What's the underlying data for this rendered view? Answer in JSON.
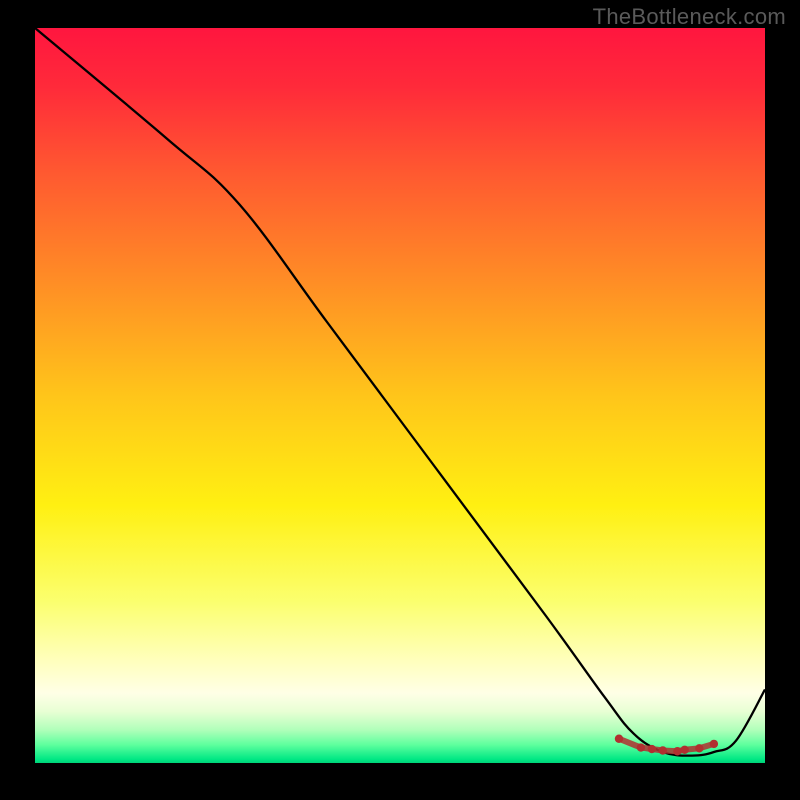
{
  "watermark": "TheBottleneck.com",
  "chart_data": {
    "type": "line",
    "title": "",
    "xlabel": "",
    "ylabel": "",
    "xlim": [
      0,
      100
    ],
    "ylim": [
      0,
      100
    ],
    "gradient_stops": [
      {
        "offset": 0.0,
        "color": "#ff163f"
      },
      {
        "offset": 0.08,
        "color": "#ff2a3a"
      },
      {
        "offset": 0.2,
        "color": "#ff5a30"
      },
      {
        "offset": 0.35,
        "color": "#ff8f25"
      },
      {
        "offset": 0.5,
        "color": "#ffc51a"
      },
      {
        "offset": 0.65,
        "color": "#fff012"
      },
      {
        "offset": 0.78,
        "color": "#fbff6e"
      },
      {
        "offset": 0.86,
        "color": "#ffffbc"
      },
      {
        "offset": 0.905,
        "color": "#ffffe6"
      },
      {
        "offset": 0.93,
        "color": "#e8ffd4"
      },
      {
        "offset": 0.955,
        "color": "#b0ffba"
      },
      {
        "offset": 0.975,
        "color": "#5fff9e"
      },
      {
        "offset": 0.995,
        "color": "#00e884"
      },
      {
        "offset": 1.0,
        "color": "#00d278"
      }
    ],
    "series": [
      {
        "name": "curve",
        "stroke": "#000000",
        "x": [
          0,
          18,
          28,
          40,
          55,
          70,
          78,
          82,
          86,
          90,
          93,
          96,
          100
        ],
        "values": [
          100,
          85,
          76,
          60,
          40,
          20,
          9,
          4,
          1.5,
          1,
          1.5,
          3,
          10
        ]
      }
    ],
    "markers": {
      "name": "optimal-region",
      "color": "#b03030",
      "x": [
        80,
        83,
        84.5,
        86,
        88,
        89,
        91,
        93
      ],
      "y": [
        3.3,
        2.1,
        1.9,
        1.7,
        1.6,
        1.8,
        2.0,
        2.6
      ]
    }
  }
}
